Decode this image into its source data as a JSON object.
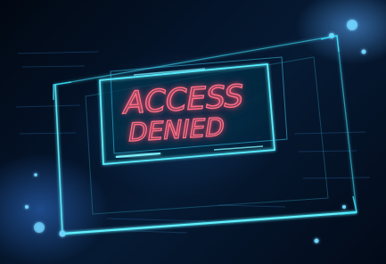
{
  "message": {
    "line1": "ACCESS",
    "line2": "DENIED"
  },
  "colors": {
    "text_glow": "#ff6f86",
    "frame_cyan": "#3fe3ff",
    "background": "#04142a"
  }
}
